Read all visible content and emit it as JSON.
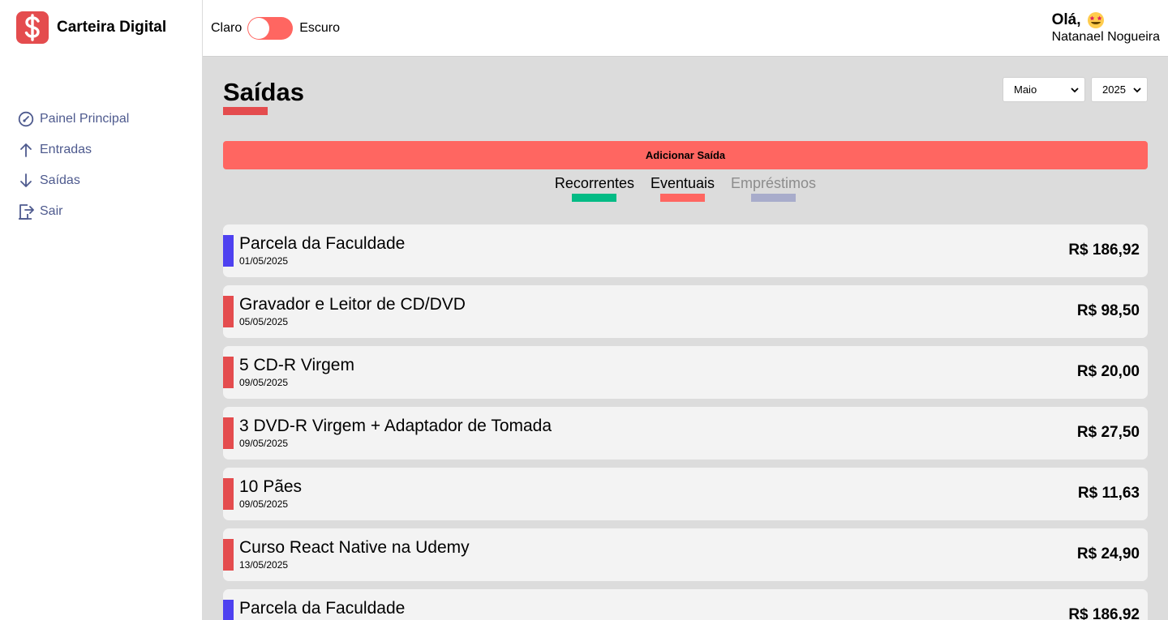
{
  "brand": {
    "name": "Carteira Digital",
    "logo_icon": "dollar-sign-icon",
    "logo_color": "#e44c4e"
  },
  "sidebar": {
    "items": [
      {
        "label": "Painel Principal",
        "icon": "dashboard-gauge-icon"
      },
      {
        "label": "Entradas",
        "icon": "arrow-up-icon"
      },
      {
        "label": "Saídas",
        "icon": "arrow-down-icon"
      },
      {
        "label": "Sair",
        "icon": "exit-door-icon"
      }
    ],
    "link_color": "#4e5a8e"
  },
  "header": {
    "theme_toggle": {
      "left_label": "Claro",
      "right_label": "Escuro",
      "state": "light"
    },
    "greeting": "Olá,",
    "greeting_emoji": "star-struck-emoji-icon",
    "user_name": "Natanael Nogueira"
  },
  "page": {
    "title": "Saídas",
    "title_accent": "#e44c4e",
    "month_select": {
      "value": "Maio"
    },
    "year_select": {
      "value": "2025"
    },
    "add_button": "Adicionar Saída",
    "filters": [
      {
        "label": "Recorrentes",
        "color": "#03bb85",
        "active": true
      },
      {
        "label": "Eventuais",
        "color": "#ff6661",
        "active": true
      },
      {
        "label": "Empréstimos",
        "color": "#a8accb",
        "active": false
      }
    ]
  },
  "entries": [
    {
      "description": "Parcela da Faculdade",
      "date": "01/05/2025",
      "amount": "R$ 186,92",
      "tag_color": "#4e41f0"
    },
    {
      "description": "Gravador e Leitor de CD/DVD",
      "date": "05/05/2025",
      "amount": "R$ 98,50",
      "tag_color": "#e44c4e"
    },
    {
      "description": "5 CD-R Virgem",
      "date": "09/05/2025",
      "amount": "R$ 20,00",
      "tag_color": "#e44c4e"
    },
    {
      "description": "3 DVD-R Virgem + Adaptador de Tomada",
      "date": "09/05/2025",
      "amount": "R$ 27,50",
      "tag_color": "#e44c4e"
    },
    {
      "description": "10 Pães",
      "date": "09/05/2025",
      "amount": "R$ 11,63",
      "tag_color": "#e44c4e"
    },
    {
      "description": "Curso React Native na Udemy",
      "date": "13/05/2025",
      "amount": "R$ 24,90",
      "tag_color": "#e44c4e"
    },
    {
      "description": "Parcela da Faculdade",
      "date": "",
      "amount": "R$ 186,92",
      "tag_color": "#4e41f0"
    }
  ]
}
